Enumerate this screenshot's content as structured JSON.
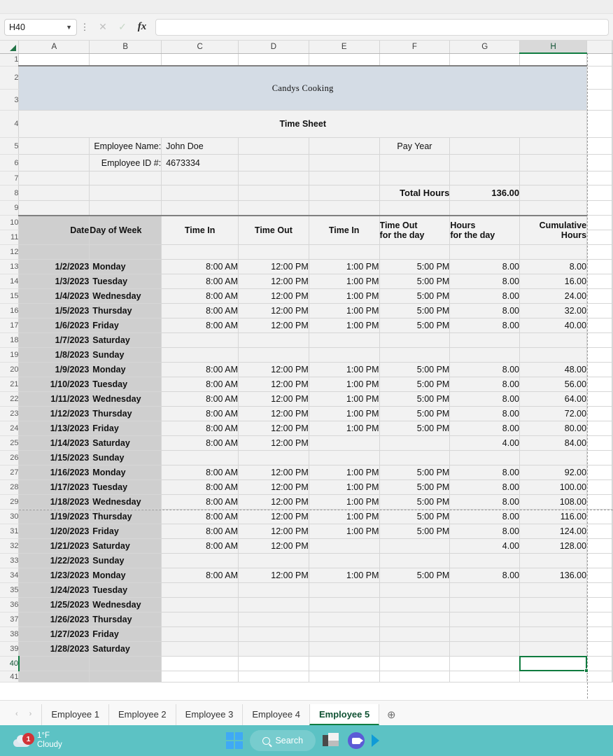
{
  "formula_bar": {
    "name_box_value": "H40",
    "formula_value": "",
    "cancel_icon": "close-icon",
    "enter_icon": "check-icon",
    "function_icon": "fx-icon"
  },
  "grid": {
    "column_headers": [
      "A",
      "B",
      "C",
      "D",
      "E",
      "F",
      "G",
      "H"
    ],
    "selected_column": "H",
    "selected_cell": "H40"
  },
  "sheet": {
    "company_title": "Candys Cooking",
    "doc_title": "Time Sheet",
    "employee_name_label": "Employee Name:",
    "employee_name_value": "John Doe",
    "employee_id_label": "Employee ID #:",
    "employee_id_value": "4673334",
    "pay_year_label": "Pay Year",
    "total_hours_label": "Total Hours",
    "total_hours_value": "136.00",
    "table_headers": {
      "date": "Date",
      "day_of_week": "Day of Week",
      "time_in_1": "Time In",
      "time_out_1": "Time Out",
      "time_in_2": "Time In",
      "time_out_day_l1": "Time Out",
      "time_out_day_l2": "for the day",
      "hours_day_l1": "Hours",
      "hours_day_l2": "for the day",
      "cumulative_l1": "Cumulative",
      "cumulative_l2": "Hours"
    },
    "rows": [
      {
        "row": 13,
        "date": "1/2/2023",
        "day": "Monday",
        "in1": "8:00 AM",
        "out1": "12:00 PM",
        "in2": "1:00 PM",
        "out2": "5:00 PM",
        "hours": "8.00",
        "cum": "8.00"
      },
      {
        "row": 14,
        "date": "1/3/2023",
        "day": "Tuesday",
        "in1": "8:00 AM",
        "out1": "12:00 PM",
        "in2": "1:00 PM",
        "out2": "5:00 PM",
        "hours": "8.00",
        "cum": "16.00"
      },
      {
        "row": 15,
        "date": "1/4/2023",
        "day": "Wednesday",
        "in1": "8:00 AM",
        "out1": "12:00 PM",
        "in2": "1:00 PM",
        "out2": "5:00 PM",
        "hours": "8.00",
        "cum": "24.00"
      },
      {
        "row": 16,
        "date": "1/5/2023",
        "day": "Thursday",
        "in1": "8:00 AM",
        "out1": "12:00 PM",
        "in2": "1:00 PM",
        "out2": "5:00 PM",
        "hours": "8.00",
        "cum": "32.00"
      },
      {
        "row": 17,
        "date": "1/6/2023",
        "day": "Friday",
        "in1": "8:00 AM",
        "out1": "12:00 PM",
        "in2": "1:00 PM",
        "out2": "5:00 PM",
        "hours": "8.00",
        "cum": "40.00"
      },
      {
        "row": 18,
        "date": "1/7/2023",
        "day": "Saturday",
        "in1": "",
        "out1": "",
        "in2": "",
        "out2": "",
        "hours": "",
        "cum": ""
      },
      {
        "row": 19,
        "date": "1/8/2023",
        "day": "Sunday",
        "in1": "",
        "out1": "",
        "in2": "",
        "out2": "",
        "hours": "",
        "cum": ""
      },
      {
        "row": 20,
        "date": "1/9/2023",
        "day": "Monday",
        "in1": "8:00 AM",
        "out1": "12:00 PM",
        "in2": "1:00 PM",
        "out2": "5:00 PM",
        "hours": "8.00",
        "cum": "48.00"
      },
      {
        "row": 21,
        "date": "1/10/2023",
        "day": "Tuesday",
        "in1": "8:00 AM",
        "out1": "12:00 PM",
        "in2": "1:00 PM",
        "out2": "5:00 PM",
        "hours": "8.00",
        "cum": "56.00"
      },
      {
        "row": 22,
        "date": "1/11/2023",
        "day": "Wednesday",
        "in1": "8:00 AM",
        "out1": "12:00 PM",
        "in2": "1:00 PM",
        "out2": "5:00 PM",
        "hours": "8.00",
        "cum": "64.00"
      },
      {
        "row": 23,
        "date": "1/12/2023",
        "day": "Thursday",
        "in1": "8:00 AM",
        "out1": "12:00 PM",
        "in2": "1:00 PM",
        "out2": "5:00 PM",
        "hours": "8.00",
        "cum": "72.00"
      },
      {
        "row": 24,
        "date": "1/13/2023",
        "day": "Friday",
        "in1": "8:00 AM",
        "out1": "12:00 PM",
        "in2": "1:00 PM",
        "out2": "5:00 PM",
        "hours": "8.00",
        "cum": "80.00"
      },
      {
        "row": 25,
        "date": "1/14/2023",
        "day": "Saturday",
        "in1": "8:00 AM",
        "out1": "12:00 PM",
        "in2": "",
        "out2": "",
        "hours": "4.00",
        "cum": "84.00"
      },
      {
        "row": 26,
        "date": "1/15/2023",
        "day": "Sunday",
        "in1": "",
        "out1": "",
        "in2": "",
        "out2": "",
        "hours": "",
        "cum": ""
      },
      {
        "row": 27,
        "date": "1/16/2023",
        "day": "Monday",
        "in1": "8:00 AM",
        "out1": "12:00 PM",
        "in2": "1:00 PM",
        "out2": "5:00 PM",
        "hours": "8.00",
        "cum": "92.00"
      },
      {
        "row": 28,
        "date": "1/17/2023",
        "day": "Tuesday",
        "in1": "8:00 AM",
        "out1": "12:00 PM",
        "in2": "1:00 PM",
        "out2": "5:00 PM",
        "hours": "8.00",
        "cum": "100.00"
      },
      {
        "row": 29,
        "date": "1/18/2023",
        "day": "Wednesday",
        "in1": "8:00 AM",
        "out1": "12:00 PM",
        "in2": "1:00 PM",
        "out2": "5:00 PM",
        "hours": "8.00",
        "cum": "108.00"
      },
      {
        "row": 30,
        "date": "1/19/2023",
        "day": "Thursday",
        "in1": "8:00 AM",
        "out1": "12:00 PM",
        "in2": "1:00 PM",
        "out2": "5:00 PM",
        "hours": "8.00",
        "cum": "116.00"
      },
      {
        "row": 31,
        "date": "1/20/2023",
        "day": "Friday",
        "in1": "8:00 AM",
        "out1": "12:00 PM",
        "in2": "1:00 PM",
        "out2": "5:00 PM",
        "hours": "8.00",
        "cum": "124.00"
      },
      {
        "row": 32,
        "date": "1/21/2023",
        "day": "Saturday",
        "in1": "8:00 AM",
        "out1": "12:00 PM",
        "in2": "",
        "out2": "",
        "hours": "4.00",
        "cum": "128.00"
      },
      {
        "row": 33,
        "date": "1/22/2023",
        "day": "Sunday",
        "in1": "",
        "out1": "",
        "in2": "",
        "out2": "",
        "hours": "",
        "cum": ""
      },
      {
        "row": 34,
        "date": "1/23/2023",
        "day": "Monday",
        "in1": "8:00 AM",
        "out1": "12:00 PM",
        "in2": "1:00 PM",
        "out2": "5:00 PM",
        "hours": "8.00",
        "cum": "136.00"
      },
      {
        "row": 35,
        "date": "1/24/2023",
        "day": "Tuesday",
        "in1": "",
        "out1": "",
        "in2": "",
        "out2": "",
        "hours": "",
        "cum": ""
      },
      {
        "row": 36,
        "date": "1/25/2023",
        "day": "Wednesday",
        "in1": "",
        "out1": "",
        "in2": "",
        "out2": "",
        "hours": "",
        "cum": ""
      },
      {
        "row": 37,
        "date": "1/26/2023",
        "day": "Thursday",
        "in1": "",
        "out1": "",
        "in2": "",
        "out2": "",
        "hours": "",
        "cum": ""
      },
      {
        "row": 38,
        "date": "1/27/2023",
        "day": "Friday",
        "in1": "",
        "out1": "",
        "in2": "",
        "out2": "",
        "hours": "",
        "cum": ""
      },
      {
        "row": 39,
        "date": "1/28/2023",
        "day": "Saturday",
        "in1": "",
        "out1": "",
        "in2": "",
        "out2": "",
        "hours": "",
        "cum": ""
      }
    ]
  },
  "tabs": {
    "prev_label": "‹",
    "next_label": "›",
    "items": [
      {
        "label": "Employee 1",
        "active": false
      },
      {
        "label": "Employee 2",
        "active": false
      },
      {
        "label": "Employee 3",
        "active": false
      },
      {
        "label": "Employee 4",
        "active": false
      },
      {
        "label": "Employee 5",
        "active": true
      }
    ],
    "add_label": "⊕"
  },
  "taskbar": {
    "weather_temp": "1°F",
    "weather_condition": "Cloudy",
    "notification_count": "1",
    "search_label": "Search",
    "accent_color": "#5cc2c4"
  }
}
